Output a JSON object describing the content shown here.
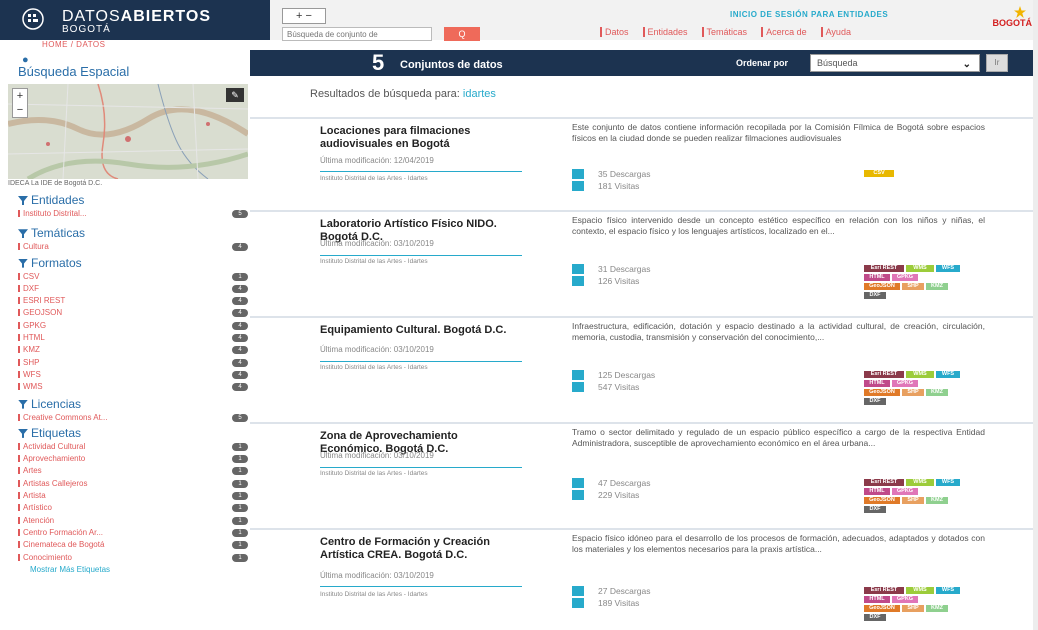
{
  "brand": {
    "name_part1": "DATOS",
    "name_part2": "ABIERTOS",
    "city": "BOGOTÁ",
    "right_logo": "BOGOTÁ"
  },
  "header": {
    "accessibility_label": "+ −",
    "search_placeholder": "Búsqueda de conjunto de",
    "search_button": "Q",
    "login": "INICIO DE SESIÓN PARA ENTIDADES",
    "nav": [
      "Datos",
      "Entidades",
      "Temáticas",
      "Acerca de",
      "Ayuda"
    ]
  },
  "breadcrumb": "HOME  /  DATOS",
  "sidebar": {
    "spatial_title": "Búsqueda Espacial",
    "map_zoom_in": "+",
    "map_zoom_out": "−",
    "map_draw": "✎",
    "map_credit": "IDECA La IDE de Bogotá D.C.",
    "facets": [
      {
        "title": "Entidades",
        "items": [
          {
            "label": "Instituto Distrital...",
            "count": "5"
          }
        ]
      },
      {
        "title": "Temáticas",
        "items": [
          {
            "label": "Cultura",
            "count": "4"
          }
        ]
      },
      {
        "title": "Formatos",
        "items": [
          {
            "label": "CSV",
            "count": "1"
          },
          {
            "label": "DXF",
            "count": "4"
          },
          {
            "label": "ESRI REST",
            "count": "4"
          },
          {
            "label": "GEOJSON",
            "count": "4"
          },
          {
            "label": "GPKG",
            "count": "4"
          },
          {
            "label": "HTML",
            "count": "4"
          },
          {
            "label": "KMZ",
            "count": "4"
          },
          {
            "label": "SHP",
            "count": "4"
          },
          {
            "label": "WFS",
            "count": "4"
          },
          {
            "label": "WMS",
            "count": "4"
          }
        ]
      },
      {
        "title": "Licencias",
        "items": [
          {
            "label": "Creative Commons At...",
            "count": "5"
          }
        ]
      },
      {
        "title": "Etiquetas",
        "items": [
          {
            "label": "Actividad Cultural",
            "count": "1"
          },
          {
            "label": "Aprovechamiento",
            "count": "1"
          },
          {
            "label": "Artes",
            "count": "1"
          },
          {
            "label": "Artistas Callejeros",
            "count": "1"
          },
          {
            "label": "Artista",
            "count": "1"
          },
          {
            "label": "Artístico",
            "count": "1"
          },
          {
            "label": "Atención",
            "count": "1"
          },
          {
            "label": "Centro Formación Ar...",
            "count": "1"
          },
          {
            "label": "Cinemateca de Bogotá",
            "count": "1"
          },
          {
            "label": "Conocimiento",
            "count": "1"
          }
        ]
      }
    ],
    "more_tags": "Mostrar Más Etiquetas"
  },
  "main": {
    "count": "5",
    "count_label": "Conjuntos de datos",
    "sort_label": "Ordenar por",
    "sort_value": "Búsqueda",
    "sort_go": "Ir",
    "results_prefix": "Resultados de búsqueda para:",
    "query": "idartes",
    "datasets": [
      {
        "title": "Locaciones para filmaciones audiovisuales en Bogotá",
        "modified": "Última modificación: 12/04/2019",
        "org": "Instituto Distrital de las Artes - Idartes",
        "desc": "Este conjunto de datos contiene información recopilada por la Comisión Fílmica de Bogotá sobre espacios físicos en la ciudad donde se pueden realizar filmaciones audiovisuales",
        "downloads": "35 Descargas",
        "views": "181 Visitas",
        "formats": [
          {
            "label": "CSV",
            "color": "#e8b800"
          }
        ]
      },
      {
        "title": "Laboratorio Artístico Físico NIDO. Bogotá D.C.",
        "modified": "Última modificación: 03/10/2019",
        "org": "Instituto Distrital de las Artes - Idartes",
        "desc": "Espacio físico intervenido desde un concepto estético específico en relación con los niños y niñas, el contexto, el espacio físico y los lenguajes artísticos, localizado en el...",
        "downloads": "31 Descargas",
        "views": "126 Visitas",
        "formats": [
          {
            "label": "Esri REST",
            "color": "#8b3a4a"
          },
          {
            "label": "WMS",
            "color": "#9ccc3a"
          },
          {
            "label": "WFS",
            "color": "#27aacb"
          },
          {
            "label": "HTML",
            "color": "#c04a8a"
          },
          {
            "label": "GPKG",
            "color": "#e076b8"
          },
          {
            "label": "GeoJSON",
            "color": "#e07a28"
          },
          {
            "label": "SHP",
            "color": "#e8a060"
          },
          {
            "label": "KMZ",
            "color": "#8fd08f"
          },
          {
            "label": "DXF",
            "color": "#666666"
          }
        ]
      },
      {
        "title": "Equipamiento Cultural. Bogotá D.C.",
        "modified": "Última modificación: 03/10/2019",
        "org": "Instituto Distrital de las Artes - Idartes",
        "desc": "Infraestructura, edificación, dotación y espacio destinado a la actividad cultural, de creación, circulación, memoria, custodia, transmisión y conservación del conocimiento,...",
        "downloads": "125 Descargas",
        "views": "547 Visitas",
        "formats": [
          {
            "label": "Esri REST",
            "color": "#8b3a4a"
          },
          {
            "label": "WMS",
            "color": "#9ccc3a"
          },
          {
            "label": "WFS",
            "color": "#27aacb"
          },
          {
            "label": "HTML",
            "color": "#c04a8a"
          },
          {
            "label": "GPKG",
            "color": "#e076b8"
          },
          {
            "label": "GeoJSON",
            "color": "#e07a28"
          },
          {
            "label": "SHP",
            "color": "#e8a060"
          },
          {
            "label": "KMZ",
            "color": "#8fd08f"
          },
          {
            "label": "DXF",
            "color": "#666666"
          }
        ]
      },
      {
        "title": "Zona de Aprovechamiento Económico. Bogotá D.C.",
        "modified": "Última modificación: 03/10/2019",
        "org": "Instituto Distrital de las Artes - Idartes",
        "desc": "Tramo o sector delimitado y regulado de un espacio público específico a cargo de la respectiva Entidad Administradora, susceptible de aprovechamiento económico en el área urbana...",
        "downloads": "47 Descargas",
        "views": "229 Visitas",
        "formats": [
          {
            "label": "Esri REST",
            "color": "#8b3a4a"
          },
          {
            "label": "WMS",
            "color": "#9ccc3a"
          },
          {
            "label": "WFS",
            "color": "#27aacb"
          },
          {
            "label": "HTML",
            "color": "#c04a8a"
          },
          {
            "label": "GPKG",
            "color": "#e076b8"
          },
          {
            "label": "GeoJSON",
            "color": "#e07a28"
          },
          {
            "label": "SHP",
            "color": "#e8a060"
          },
          {
            "label": "KMZ",
            "color": "#8fd08f"
          },
          {
            "label": "DXF",
            "color": "#666666"
          }
        ]
      },
      {
        "title": "Centro de Formación y Creación Artística CREA. Bogotá D.C.",
        "modified": "Última modificación: 03/10/2019",
        "org": "Instituto Distrital de las Artes - Idartes",
        "desc": "Espacio físico idóneo para el desarrollo de los procesos de formación, adecuados, adaptados y dotados con los materiales y los elementos necesarios para la praxis artística...",
        "downloads": "27 Descargas",
        "views": "189 Visitas",
        "formats": [
          {
            "label": "Esri REST",
            "color": "#8b3a4a"
          },
          {
            "label": "WMS",
            "color": "#9ccc3a"
          },
          {
            "label": "WFS",
            "color": "#27aacb"
          },
          {
            "label": "HTML",
            "color": "#c04a8a"
          },
          {
            "label": "GPKG",
            "color": "#e076b8"
          },
          {
            "label": "GeoJSON",
            "color": "#e07a28"
          },
          {
            "label": "SHP",
            "color": "#e8a060"
          },
          {
            "label": "KMZ",
            "color": "#8fd08f"
          },
          {
            "label": "DXF",
            "color": "#666666"
          }
        ]
      }
    ]
  }
}
